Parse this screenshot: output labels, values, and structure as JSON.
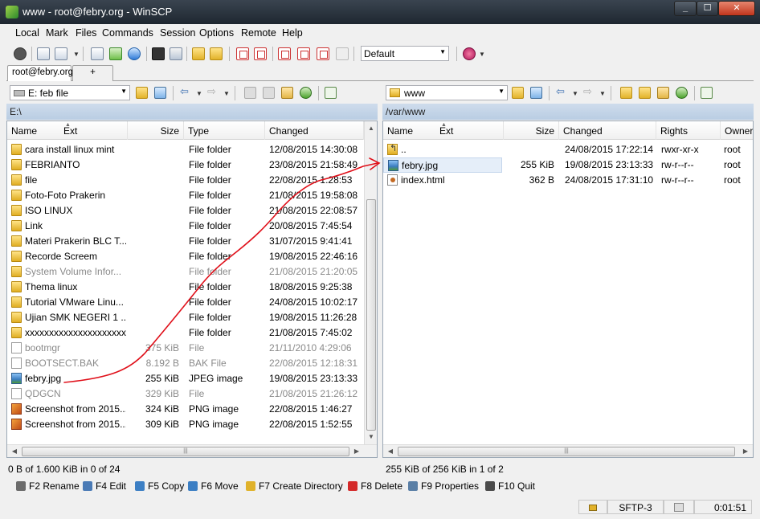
{
  "window": {
    "title": "www - root@febry.org - WinSCP"
  },
  "menu": [
    "Local",
    "Mark",
    "Files",
    "Commands",
    "Session",
    "Options",
    "Remote",
    "Help"
  ],
  "toolbar": {
    "transfer_setting": "Default"
  },
  "tabs": [
    {
      "label": "root@febry.org"
    },
    {
      "label": "+"
    }
  ],
  "left": {
    "drive": "E: feb file",
    "path": "E:\\",
    "columns": {
      "name": "Name",
      "ext": "Ext",
      "size": "Size",
      "type": "Type",
      "changed": "Changed"
    },
    "files": [
      {
        "name": "cara install linux mint",
        "size": "",
        "type": "File folder",
        "changed": "12/08/2015  14:30:08",
        "icon": "folder",
        "dim": false
      },
      {
        "name": "FEBRIANTO",
        "size": "",
        "type": "File folder",
        "changed": "23/08/2015  21:58:49",
        "icon": "folder",
        "dim": false
      },
      {
        "name": "file",
        "size": "",
        "type": "File folder",
        "changed": "22/08/2015   1:28:53",
        "icon": "folder",
        "dim": false
      },
      {
        "name": "Foto-Foto Prakerin",
        "size": "",
        "type": "File folder",
        "changed": "21/08/2015  19:58:08",
        "icon": "folder",
        "dim": false
      },
      {
        "name": "ISO LINUX",
        "size": "",
        "type": "File folder",
        "changed": "21/08/2015  22:08:57",
        "icon": "folder",
        "dim": false
      },
      {
        "name": "Link",
        "size": "",
        "type": "File folder",
        "changed": "20/08/2015   7:45:54",
        "icon": "folder",
        "dim": false
      },
      {
        "name": "Materi Prakerin BLC T...",
        "size": "",
        "type": "File folder",
        "changed": "31/07/2015   9:41:41",
        "icon": "folder",
        "dim": false
      },
      {
        "name": "Recorde Screem",
        "size": "",
        "type": "File folder",
        "changed": "19/08/2015  22:46:16",
        "icon": "folder",
        "dim": false
      },
      {
        "name": "System Volume Infor...",
        "size": "",
        "type": "File folder",
        "changed": "21/08/2015  21:20:05",
        "icon": "folder",
        "dim": true
      },
      {
        "name": "Thema linux",
        "size": "",
        "type": "File folder",
        "changed": "18/08/2015   9:25:38",
        "icon": "folder",
        "dim": false
      },
      {
        "name": "Tutorial VMware Linu...",
        "size": "",
        "type": "File folder",
        "changed": "24/08/2015  10:02:17",
        "icon": "folder",
        "dim": false
      },
      {
        "name": "Ujian SMK NEGERI 1 ...",
        "size": "",
        "type": "File folder",
        "changed": "19/08/2015  11:26:28",
        "icon": "folder",
        "dim": false
      },
      {
        "name": "xxxxxxxxxxxxxxxxxxxxxx",
        "size": "",
        "type": "File folder",
        "changed": "21/08/2015   7:45:02",
        "icon": "folder",
        "dim": false
      },
      {
        "name": "bootmgr",
        "size": "375 KiB",
        "type": "File",
        "changed": "21/11/2010   4:29:06",
        "icon": "file",
        "dim": true
      },
      {
        "name": "BOOTSECT.BAK",
        "size": "8.192 B",
        "type": "BAK File",
        "changed": "22/08/2015  12:18:31",
        "icon": "file",
        "dim": true
      },
      {
        "name": "febry.jpg",
        "size": "255 KiB",
        "type": "JPEG image",
        "changed": "19/08/2015  23:13:33",
        "icon": "img",
        "dim": false
      },
      {
        "name": "QDGCN",
        "size": "329 KiB",
        "type": "File",
        "changed": "21/08/2015  21:26:12",
        "icon": "file",
        "dim": true
      },
      {
        "name": "Screenshot from 2015...",
        "size": "324 KiB",
        "type": "PNG image",
        "changed": "22/08/2015   1:46:27",
        "icon": "png",
        "dim": false
      },
      {
        "name": "Screenshot from 2015...",
        "size": "309 KiB",
        "type": "PNG image",
        "changed": "22/08/2015   1:52:55",
        "icon": "png",
        "dim": false
      }
    ],
    "status": "0 B of 1.600 KiB in 0 of 24"
  },
  "right": {
    "folder": "www",
    "path": "/var/www",
    "columns": {
      "name": "Name",
      "ext": "Ext",
      "size": "Size",
      "changed": "Changed",
      "rights": "Rights",
      "owner": "Owner"
    },
    "files": [
      {
        "name": "..",
        "size": "",
        "changed": "24/08/2015  17:22:14",
        "rights": "rwxr-xr-x",
        "owner": "root",
        "icon": "up",
        "sel": false
      },
      {
        "name": "febry.jpg",
        "size": "255 KiB",
        "changed": "19/08/2015  23:13:33",
        "rights": "rw-r--r--",
        "owner": "root",
        "icon": "img",
        "sel": true
      },
      {
        "name": "index.html",
        "size": "362 B",
        "changed": "24/08/2015  17:31:10",
        "rights": "rw-r--r--",
        "owner": "root",
        "icon": "html",
        "sel": false
      }
    ],
    "status": "255 KiB of 256 KiB in 1 of 2"
  },
  "keys": [
    {
      "label": "F2 Rename",
      "color": "#6b6b6b"
    },
    {
      "label": "F4 Edit",
      "color": "#4a7ab5"
    },
    {
      "label": "F5 Copy",
      "color": "#3c7fc4"
    },
    {
      "label": "F6 Move",
      "color": "#3c7fc4"
    },
    {
      "label": "F7 Create Directory",
      "color": "#e0b22a"
    },
    {
      "label": "F8 Delete",
      "color": "#d42a2a"
    },
    {
      "label": "F9 Properties",
      "color": "#5a7fa6"
    },
    {
      "label": "F10 Quit",
      "color": "#4a4a4a"
    }
  ],
  "statusbar": {
    "protocol": "SFTP-3",
    "elapsed": "0:01:51"
  },
  "colors": {
    "annotation": "#e0101a",
    "title_bar": "#243039",
    "path_bar": "#c2d3e7"
  }
}
